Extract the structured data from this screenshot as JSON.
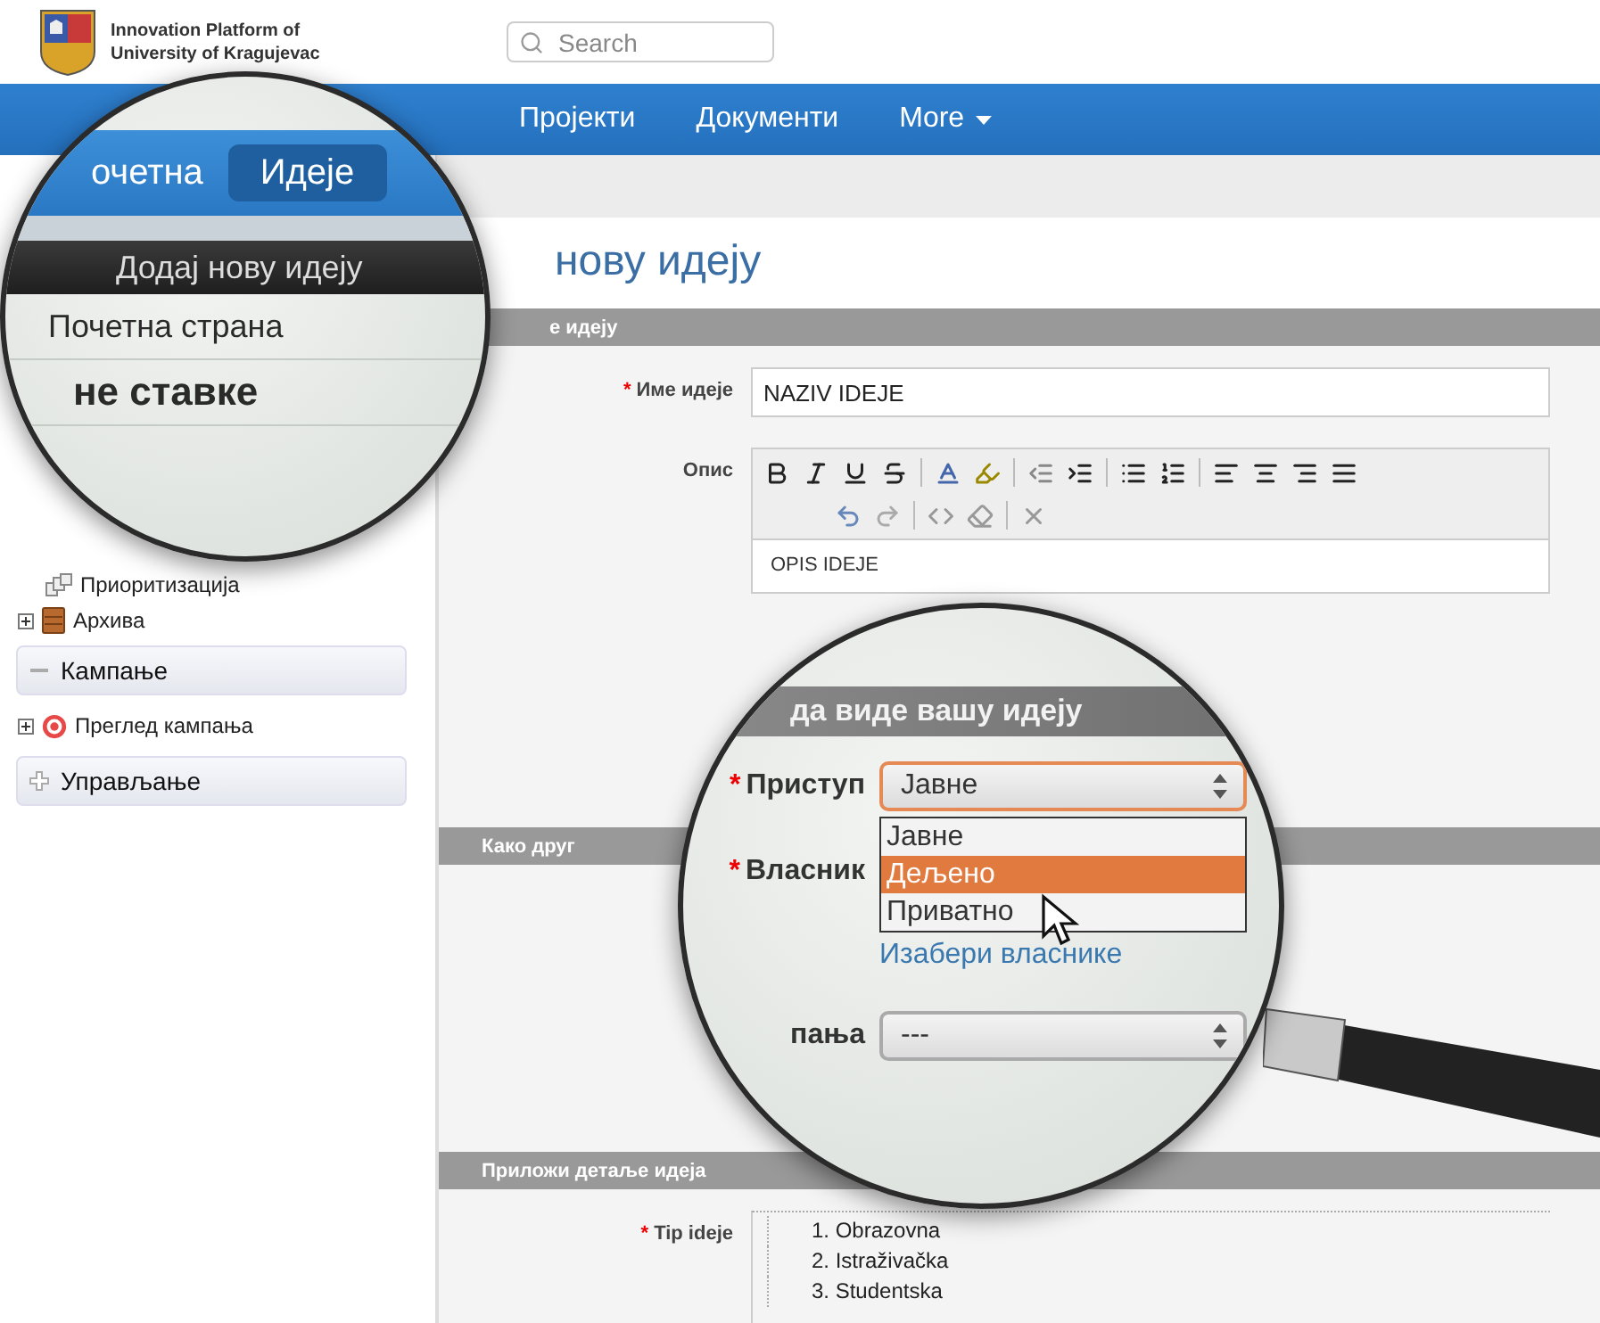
{
  "header": {
    "logo_lines": [
      "Innovation Platform of",
      "University of Kragujevac"
    ],
    "search_placeholder": "Search"
  },
  "nav": [
    {
      "label": "Пројекти",
      "selected": false,
      "dropdown": false
    },
    {
      "label": "Документи",
      "selected": false,
      "dropdown": false
    },
    {
      "label": "More",
      "selected": false,
      "dropdown": true
    }
  ],
  "magnifier_top": {
    "nav": [
      {
        "label": "очетна",
        "selected": false
      },
      {
        "label": "Идеје",
        "selected": true
      }
    ],
    "sidebar_heading": "Додај нову идеју",
    "items": [
      "Почетна страна",
      "не ставке"
    ]
  },
  "sidebar": {
    "tree": [
      {
        "label": "Приоритизација",
        "kind": "numbers",
        "expander": false
      },
      {
        "label": "Архива",
        "kind": "cabinet",
        "expander": true
      }
    ],
    "panels": [
      {
        "label": "Кампање",
        "expanded": true,
        "items": [
          {
            "label": "Преглед кампања",
            "kind": "target",
            "expander": true
          }
        ]
      },
      {
        "label": "Управљање",
        "expanded": false
      }
    ]
  },
  "page": {
    "title": "нову идеју",
    "section_1": "е идеју",
    "name": {
      "mark": "*",
      "label": "Име идеје",
      "value": "NAZIV IDEJE"
    },
    "description": {
      "label": "Опис",
      "value": "OPIS IDEJE"
    },
    "section_2": "Како друг",
    "section_3": "Приложи детаље идеја",
    "type": {
      "mark": "*",
      "label": "Tip ideje",
      "options": [
        "1. Obrazovna",
        "2. Istraživačka",
        "3. Studentska"
      ]
    }
  },
  "magnifier_form": {
    "section": "да виде вашу идеју",
    "access": {
      "mark": "*",
      "label": "Приступ",
      "value": "Јавне",
      "options": [
        {
          "label": "Јавне",
          "highlighted": false
        },
        {
          "label": "Дељено",
          "highlighted": true
        },
        {
          "label": "Приватно",
          "highlighted": false
        }
      ]
    },
    "owner": {
      "mark": "*",
      "label": "Власник",
      "link": "Изабери власнике"
    },
    "campaign": {
      "label": "пања",
      "value": "---"
    }
  }
}
